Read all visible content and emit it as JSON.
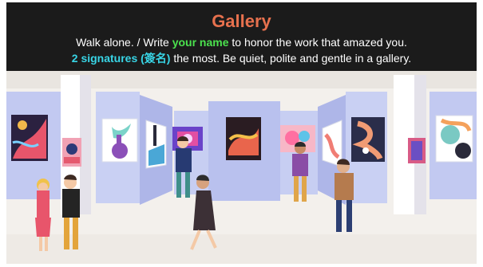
{
  "header": {
    "title": "Gallery",
    "line1": {
      "before": "Walk alone. / Write ",
      "highlight": "your name",
      "after": " to honor the work that amazed you."
    },
    "line2": {
      "highlight": "2 signatures (簽名)",
      "after": " the most. Be quiet, polite and gentle in a gallery."
    }
  },
  "colors": {
    "header_bg": "#1b1b1b",
    "title": "#e7714e",
    "green_highlight": "#4be24e",
    "cyan_highlight": "#38d5e6",
    "floor": "#f3f0ec",
    "wall_panel": "#c9d0f3"
  },
  "illustration": {
    "name": "art-gallery-illustration",
    "people": 7,
    "artworks": 12
  }
}
